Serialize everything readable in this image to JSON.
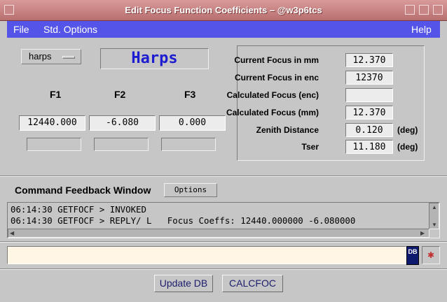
{
  "window": {
    "title": "Edit Focus Function Coefficients – @w3p6tcs"
  },
  "menubar": {
    "file": "File",
    "std_options": "Std. Options",
    "help": "Help"
  },
  "instrument": {
    "selector_value": "harps",
    "name": "Harps"
  },
  "coefficients": {
    "headers": [
      "F1",
      "F2",
      "F3"
    ],
    "values": [
      "12440.000",
      "-6.080",
      "0.000"
    ],
    "edit_values": [
      "",
      "",
      ""
    ]
  },
  "focus": {
    "current_mm_label": "Current Focus in mm",
    "current_mm": "12.370",
    "current_enc_label": "Current Focus in enc",
    "current_enc": "12370",
    "calc_enc_label": "Calculated Focus (enc)",
    "calc_enc": "",
    "calc_mm_label": "Calculated Focus (mm)",
    "calc_mm": "12.370",
    "zenith_label": "Zenith Distance",
    "zenith": "0.120",
    "zenith_unit": "(deg)",
    "tser_label": "Tser",
    "tser": "11.180",
    "tser_unit": "(deg)"
  },
  "feedback": {
    "title": "Command Feedback Window",
    "options_label": "Options",
    "lines": [
      "06:14:30 GETFOCF > INVOKED",
      "06:14:30 GETFOCF > REPLY/ L   Focus Coeffs: 12440.000000 -6.080000"
    ]
  },
  "command": {
    "input_value": "",
    "db_label": "DB"
  },
  "buttons": {
    "update_db": "Update DB",
    "calcfoc": "CALCFOC"
  }
}
